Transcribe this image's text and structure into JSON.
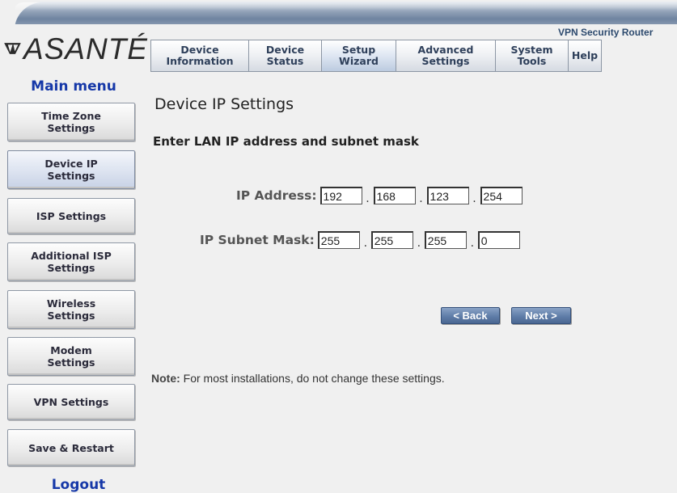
{
  "header": {
    "logo_text": "ASANTÉ",
    "product": "VPN Security Router"
  },
  "tabs": [
    {
      "label": "Device\nInformation",
      "active": false
    },
    {
      "label": "Device\nStatus",
      "active": false
    },
    {
      "label": "Setup\nWizard",
      "active": true
    },
    {
      "label": "Advanced\nSettings",
      "active": false
    },
    {
      "label": "System\nTools",
      "active": false
    },
    {
      "label": "Help",
      "active": false
    }
  ],
  "sidebar": {
    "title": "Main menu",
    "items": [
      {
        "label": "Time Zone\nSettings",
        "active": false
      },
      {
        "label": "Device IP\nSettings",
        "active": true
      },
      {
        "label": "ISP Settings",
        "active": false
      },
      {
        "label": "Additional ISP\nSettings",
        "active": false
      },
      {
        "label": "Wireless\nSettings",
        "active": false
      },
      {
        "label": "Modem\nSettings",
        "active": false
      },
      {
        "label": "VPN Settings",
        "active": false
      },
      {
        "label": "Save & Restart",
        "active": false
      }
    ],
    "logout": "Logout"
  },
  "main": {
    "title": "Device IP Settings",
    "subtitle": "Enter LAN IP address and subnet mask",
    "ip_address": {
      "label": "IP Address:",
      "octets": [
        "192",
        "168",
        "123",
        "254"
      ]
    },
    "subnet_mask": {
      "label": "IP Subnet Mask:",
      "octets": [
        "255",
        "255",
        "255",
        "0"
      ]
    },
    "back_label": "< Back",
    "next_label": "Next >",
    "note_label": "Note:",
    "note_text": " For most installations, do not change these settings."
  },
  "colors": {
    "menu_title": "#1638a8",
    "nav_button": "#5f7da8",
    "tab_text": "#2e3f5a"
  }
}
